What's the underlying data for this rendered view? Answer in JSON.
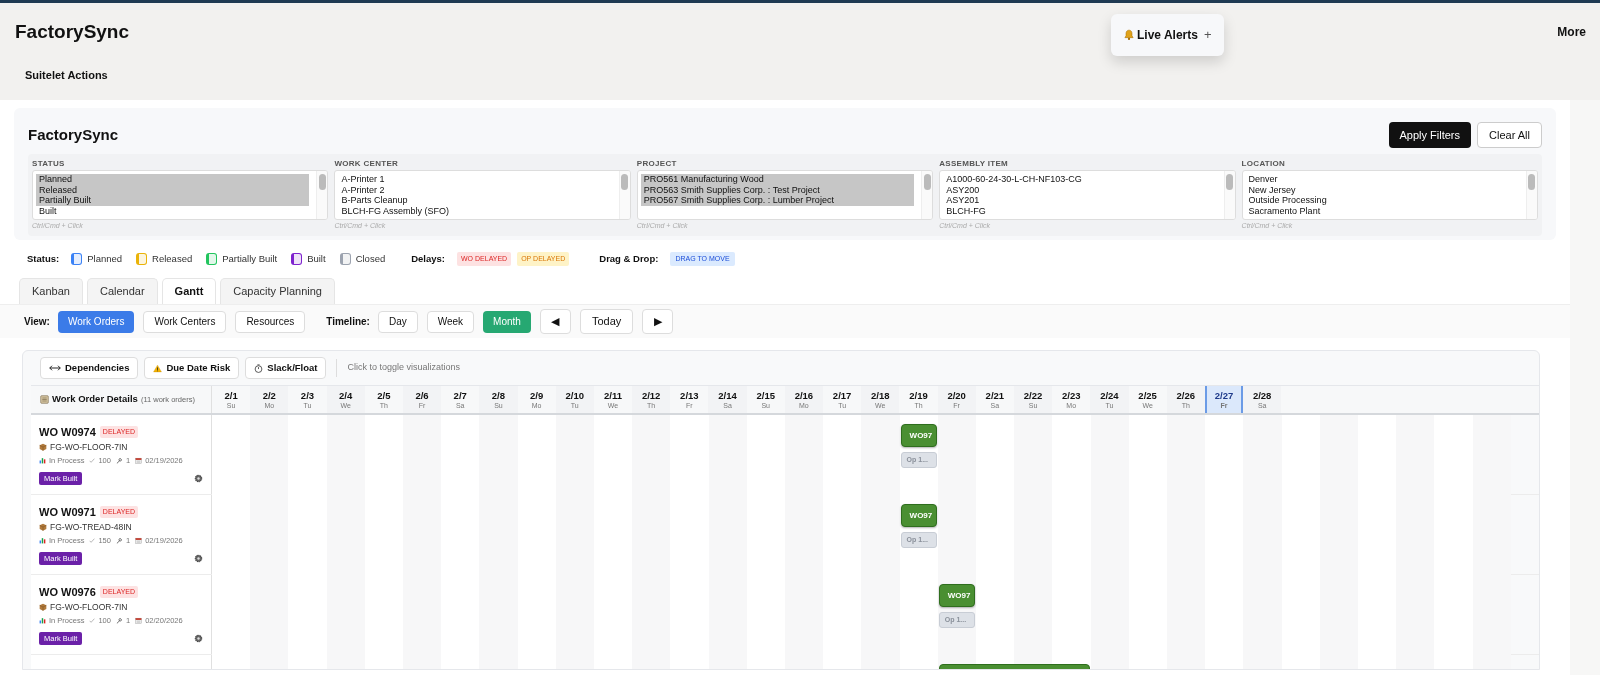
{
  "app": {
    "title": "FactorySync",
    "actions_link": "Suitelet Actions",
    "more": "More"
  },
  "live_alerts": {
    "label": "Live Alerts",
    "expand_glyph": "+"
  },
  "filters": {
    "title": "FactorySync",
    "apply": "Apply Filters",
    "clear": "Clear All",
    "fields": [
      {
        "label": "STATUS",
        "hint": "Ctrl/Cmd + Click",
        "options": [
          {
            "text": "Planned",
            "selected": true
          },
          {
            "text": "Released",
            "selected": true
          },
          {
            "text": "Partially Built",
            "selected": true
          },
          {
            "text": "Built",
            "selected": false
          }
        ]
      },
      {
        "label": "WORK CENTER",
        "hint": "Ctrl/Cmd + Click",
        "options": [
          {
            "text": "A-Printer 1",
            "selected": false
          },
          {
            "text": "A-Printer 2",
            "selected": false
          },
          {
            "text": "B-Parts Cleanup",
            "selected": false
          },
          {
            "text": "BLCH-FG Assembly (SFO)",
            "selected": false
          }
        ]
      },
      {
        "label": "PROJECT",
        "hint": "Ctrl/Cmd + Click",
        "options": [
          {
            "text": "PRO561 Manufacturing Wood",
            "selected": true
          },
          {
            "text": "PRO563 Smith Supplies Corp. : Test Project",
            "selected": true
          },
          {
            "text": "PRO567 Smith Supplies Corp. : Lumber Project",
            "selected": true
          }
        ]
      },
      {
        "label": "ASSEMBLY ITEM",
        "hint": "Ctrl/Cmd + Click",
        "options": [
          {
            "text": "A1000-60-24-30-L-CH-NF103-CG",
            "selected": false
          },
          {
            "text": "ASY200",
            "selected": false
          },
          {
            "text": "ASY201",
            "selected": false
          },
          {
            "text": "BLCH-FG",
            "selected": false
          }
        ]
      },
      {
        "label": "LOCATION",
        "hint": "Ctrl/Cmd + Click",
        "options": [
          {
            "text": "Denver",
            "selected": false
          },
          {
            "text": "New Jersey",
            "selected": false
          },
          {
            "text": "Outside Processing",
            "selected": false
          },
          {
            "text": "Sacramento Plant",
            "selected": false
          }
        ]
      }
    ]
  },
  "legend": {
    "status_label": "Status:",
    "statuses": [
      {
        "label": "Planned",
        "color": "#3b82f6"
      },
      {
        "label": "Released",
        "color": "#eab308"
      },
      {
        "label": "Partially Built",
        "color": "#22c55e"
      },
      {
        "label": "Built",
        "color": "#7e22ce"
      },
      {
        "label": "Closed",
        "color": "#9ca3af"
      }
    ],
    "delays_label": "Delays:",
    "delays": [
      {
        "label": "WO DELAYED",
        "kind": "wo"
      },
      {
        "label": "OP DELAYED",
        "kind": "op"
      }
    ],
    "drag_label": "Drag & Drop:",
    "drag_badge": "DRAG TO MOVE"
  },
  "tabs": [
    {
      "label": "Kanban",
      "selected": false
    },
    {
      "label": "Calendar",
      "selected": false
    },
    {
      "label": "Gantt",
      "selected": true
    },
    {
      "label": "Capacity Planning",
      "selected": false
    }
  ],
  "view": {
    "label": "View:",
    "options": [
      {
        "label": "Work Orders",
        "selected": true
      },
      {
        "label": "Work Centers",
        "selected": false
      },
      {
        "label": "Resources",
        "selected": false
      }
    ]
  },
  "timeline": {
    "label": "Timeline:",
    "options": [
      {
        "label": "Day",
        "selected": false
      },
      {
        "label": "Week",
        "selected": false
      },
      {
        "label": "Month",
        "selected": true
      }
    ],
    "prev": "◀",
    "today": "Today",
    "next": "▶"
  },
  "gantt": {
    "toggles": [
      {
        "label": "Dependencies",
        "kind": "dependencies"
      },
      {
        "label": "Due Date Risk",
        "kind": "risk"
      },
      {
        "label": "Slack/Float",
        "kind": "slack"
      }
    ],
    "toggle_hint": "Click to toggle visualizations",
    "details_title": "Work Order Details",
    "details_count": "(11 work orders)",
    "days": [
      {
        "date": "2/1",
        "dow": "Su",
        "today": false
      },
      {
        "date": "2/2",
        "dow": "Mo",
        "today": false
      },
      {
        "date": "2/3",
        "dow": "Tu",
        "today": false
      },
      {
        "date": "2/4",
        "dow": "We",
        "today": false
      },
      {
        "date": "2/5",
        "dow": "Th",
        "today": false
      },
      {
        "date": "2/6",
        "dow": "Fr",
        "today": false
      },
      {
        "date": "2/7",
        "dow": "Sa",
        "today": false
      },
      {
        "date": "2/8",
        "dow": "Su",
        "today": false
      },
      {
        "date": "2/9",
        "dow": "Mo",
        "today": false
      },
      {
        "date": "2/10",
        "dow": "Tu",
        "today": false
      },
      {
        "date": "2/11",
        "dow": "We",
        "today": false
      },
      {
        "date": "2/12",
        "dow": "Th",
        "today": false
      },
      {
        "date": "2/13",
        "dow": "Fr",
        "today": false
      },
      {
        "date": "2/14",
        "dow": "Sa",
        "today": false
      },
      {
        "date": "2/15",
        "dow": "Su",
        "today": false
      },
      {
        "date": "2/16",
        "dow": "Mo",
        "today": false
      },
      {
        "date": "2/17",
        "dow": "Tu",
        "today": false
      },
      {
        "date": "2/18",
        "dow": "We",
        "today": false
      },
      {
        "date": "2/19",
        "dow": "Th",
        "today": false
      },
      {
        "date": "2/20",
        "dow": "Fr",
        "today": false
      },
      {
        "date": "2/21",
        "dow": "Sa",
        "today": false
      },
      {
        "date": "2/22",
        "dow": "Su",
        "today": false
      },
      {
        "date": "2/23",
        "dow": "Mo",
        "today": false
      },
      {
        "date": "2/24",
        "dow": "Tu",
        "today": false
      },
      {
        "date": "2/25",
        "dow": "We",
        "today": false
      },
      {
        "date": "2/26",
        "dow": "Th",
        "today": false
      },
      {
        "date": "2/27",
        "dow": "Fr",
        "today": true
      },
      {
        "date": "2/28",
        "dow": "Sa",
        "today": false
      }
    ],
    "rows": [
      {
        "wo": "WO W0974",
        "delayed": true,
        "badge": "DELAYED",
        "item": "FG-WO-FLOOR-7IN",
        "status": "In Process",
        "qty": "100",
        "ops": "1",
        "due": "02/19/2026",
        "action": "Mark Built",
        "bar_label": "WO97",
        "op_label": "Op 1..."
      },
      {
        "wo": "WO W0971",
        "delayed": true,
        "badge": "DELAYED",
        "item": "FG-WO-TREAD-48IN",
        "status": "In Process",
        "qty": "150",
        "ops": "1",
        "due": "02/19/2026",
        "action": "Mark Built",
        "bar_label": "WO97",
        "op_label": "Op 1..."
      },
      {
        "wo": "WO W0976",
        "delayed": true,
        "badge": "DELAYED",
        "item": "FG-WO-FLOOR-7IN",
        "status": "In Process",
        "qty": "100",
        "ops": "1",
        "due": "02/20/2026",
        "action": "Mark Built",
        "bar_label": "WO97",
        "op_label": "Op 1..."
      }
    ]
  }
}
